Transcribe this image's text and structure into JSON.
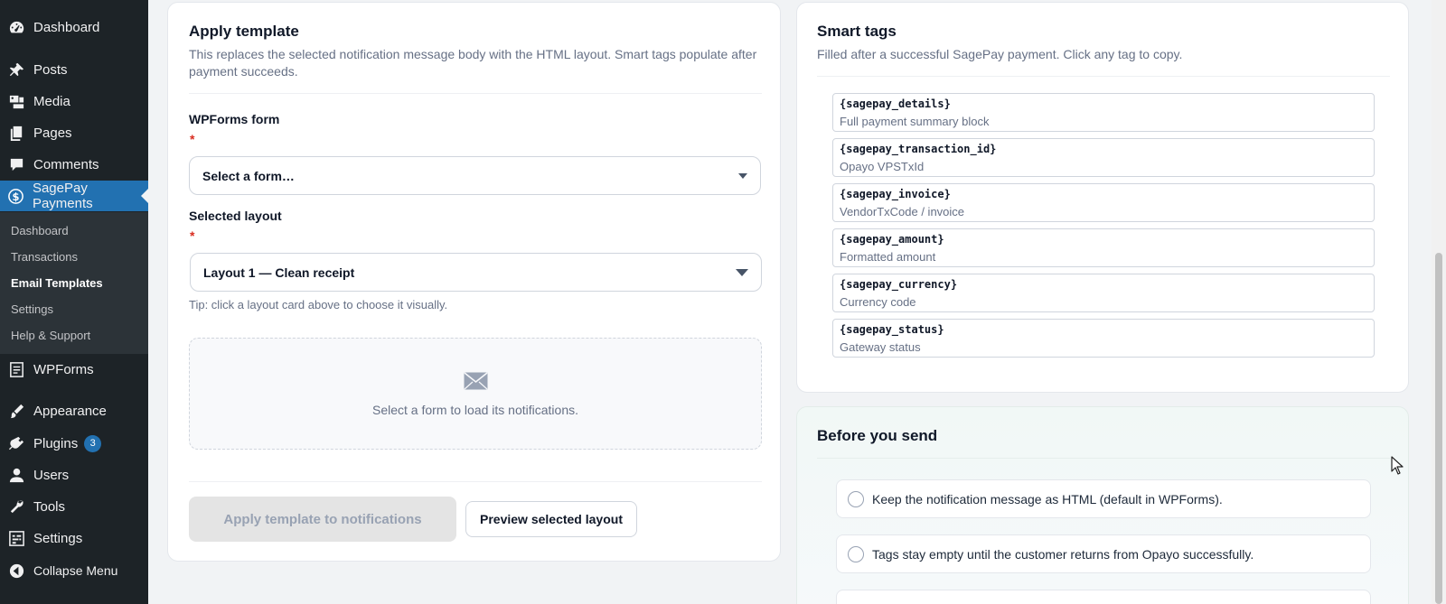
{
  "sidebar": {
    "items": [
      {
        "label": "Dashboard",
        "icon": "dashboard-icon"
      },
      {
        "label": "Posts",
        "icon": "pin-icon"
      },
      {
        "label": "Media",
        "icon": "media-icon"
      },
      {
        "label": "Pages",
        "icon": "pages-icon"
      },
      {
        "label": "Comments",
        "icon": "comment-icon"
      },
      {
        "label": "SagePay Payments",
        "icon": "dollar-icon"
      },
      {
        "label": "WPForms",
        "icon": "wpforms-icon"
      },
      {
        "label": "Appearance",
        "icon": "brush-icon"
      },
      {
        "label": "Plugins",
        "icon": "plug-icon",
        "badge": "3"
      },
      {
        "label": "Users",
        "icon": "user-icon"
      },
      {
        "label": "Tools",
        "icon": "wrench-icon"
      },
      {
        "label": "Settings",
        "icon": "settings-icon"
      },
      {
        "label": "Collapse Menu",
        "icon": "collapse-icon"
      }
    ],
    "submenu": [
      "Dashboard",
      "Transactions",
      "Email Templates",
      "Settings",
      "Help & Support"
    ],
    "current_submenu": "Email Templates",
    "accent_color": "#2271b1"
  },
  "apply": {
    "title": "Apply template",
    "description": "This replaces the selected notification message body with the HTML layout. Smart tags populate after payment succeeds.",
    "form_label": "WPForms form",
    "required_mark": "*",
    "form_select": "Select a form…",
    "layout_label": "Selected layout",
    "layout_select": "Layout 1 — Clean receipt",
    "tip": "Tip: click a layout card above to choose it visually.",
    "empty_text": "Select a form to load its notifications.",
    "apply_button": "Apply template to notifications",
    "preview_button": "Preview selected layout"
  },
  "smart_tags": {
    "title": "Smart tags",
    "description": "Filled after a successful SagePay payment. Click any tag to copy.",
    "tags": [
      {
        "code": "{sagepay_details}",
        "desc": "Full payment summary block"
      },
      {
        "code": "{sagepay_transaction_id}",
        "desc": "Opayo VPSTxId"
      },
      {
        "code": "{sagepay_invoice}",
        "desc": "VendorTxCode / invoice"
      },
      {
        "code": "{sagepay_amount}",
        "desc": "Formatted amount"
      },
      {
        "code": "{sagepay_currency}",
        "desc": "Currency code"
      },
      {
        "code": "{sagepay_status}",
        "desc": "Gateway status"
      }
    ]
  },
  "before_send": {
    "title": "Before you send",
    "items": [
      "Keep the notification message as HTML (default in WPForms).",
      "Tags stay empty until the customer returns from Opayo successfully."
    ]
  }
}
